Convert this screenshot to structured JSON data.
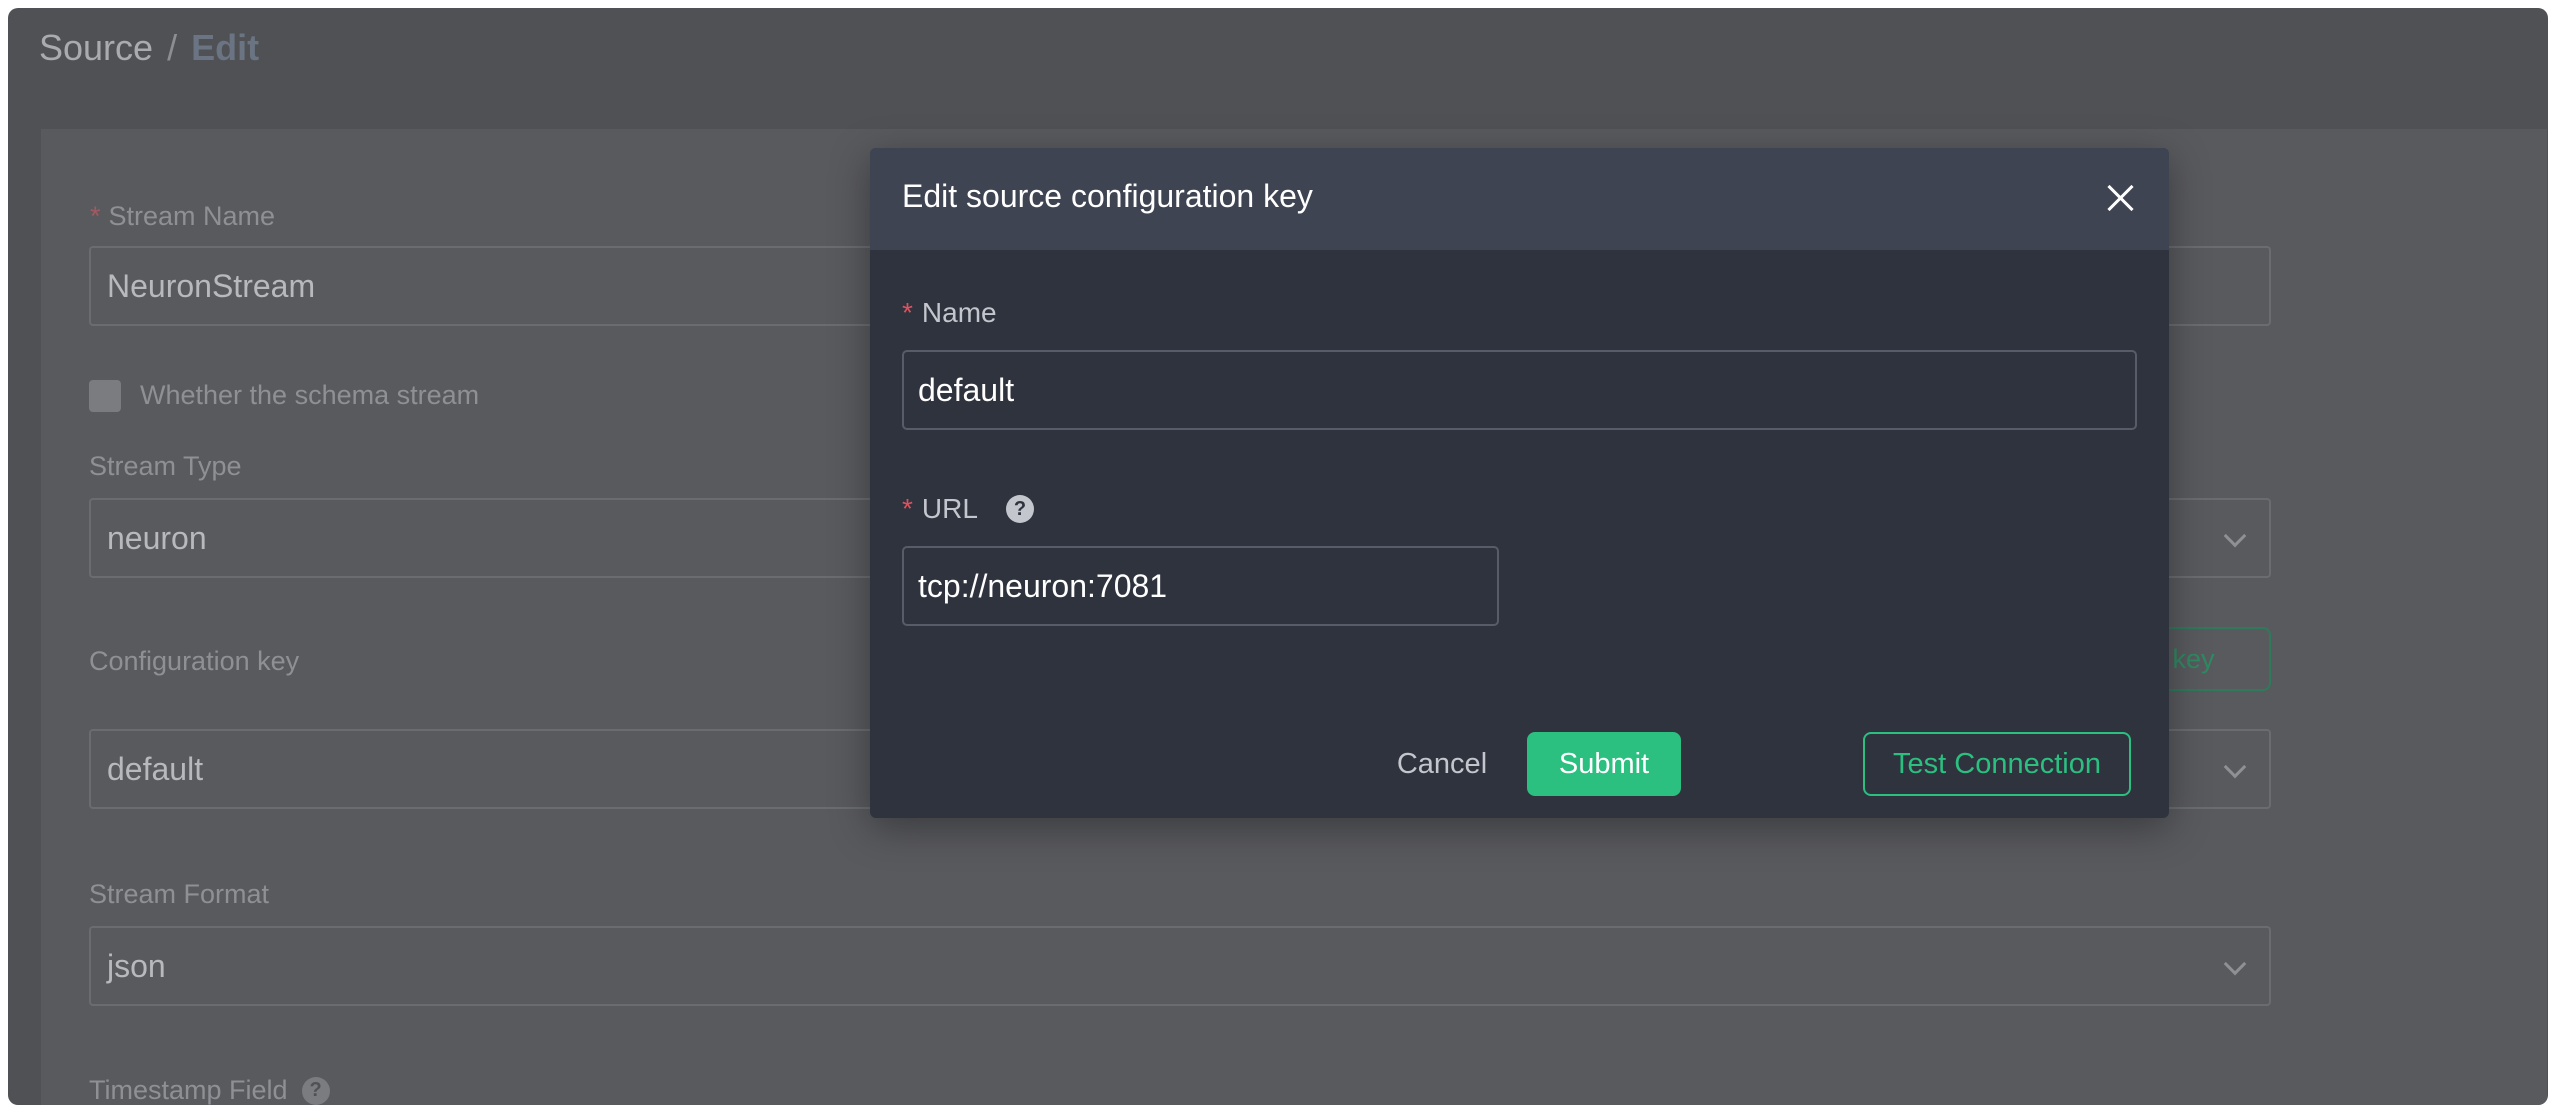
{
  "breadcrumb": {
    "parent": "Source",
    "separator": "/",
    "current": "Edit"
  },
  "form": {
    "stream_name": {
      "label": "Stream Name",
      "value": "NeuronStream"
    },
    "schema_checkbox": {
      "label": "Whether the schema stream",
      "checked": false
    },
    "stream_type": {
      "label": "Stream Type",
      "value": "neuron"
    },
    "configuration_key": {
      "label": "Configuration key",
      "value": "default",
      "button_label_visible": "n key"
    },
    "stream_format": {
      "label": "Stream Format",
      "value": "json"
    },
    "timestamp_field": {
      "label": "Timestamp Field"
    }
  },
  "modal": {
    "title": "Edit source configuration key",
    "name": {
      "label": "Name",
      "value": "default"
    },
    "url": {
      "label": "URL",
      "value": "tcp://neuron:7081"
    },
    "buttons": {
      "cancel": "Cancel",
      "submit": "Submit",
      "test": "Test Connection"
    }
  },
  "colors": {
    "primary": "#2bbf80",
    "required": "#e0505d",
    "modal_bg": "#2f333e",
    "modal_header_bg": "#3f4452"
  },
  "icons": {
    "close": "close-icon",
    "help": "question-circle-icon",
    "chevron": "chevron-down-icon"
  }
}
